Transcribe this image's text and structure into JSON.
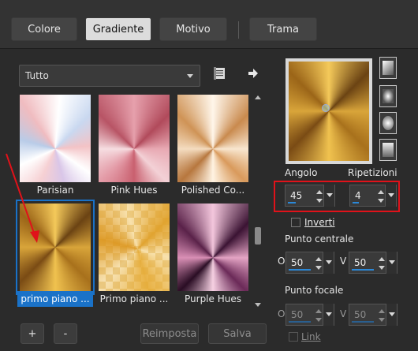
{
  "tabs": [
    {
      "label": "Colore",
      "active": false
    },
    {
      "label": "Gradiente",
      "active": true
    },
    {
      "label": "Motivo",
      "active": false
    },
    {
      "label": "Trama",
      "active": false
    }
  ],
  "category_dropdown": {
    "value": "Tutto"
  },
  "presets": [
    {
      "name": "Parisian",
      "selected": false
    },
    {
      "name": "Pink Hues",
      "selected": false
    },
    {
      "name": "Polished Co...",
      "selected": false
    },
    {
      "name": "primo piano ...",
      "selected": true
    },
    {
      "name": "Primo piano ...",
      "selected": false
    },
    {
      "name": "Purple Hues",
      "selected": false
    }
  ],
  "buttons": {
    "add": "+",
    "remove": "-",
    "reset": "Reimposta",
    "save": "Salva"
  },
  "settings": {
    "angle_label": "Angolo",
    "repeats_label": "Ripetizioni",
    "angle_value": "45",
    "angle_fraction": 0.125,
    "repeats_value": "4",
    "repeats_fraction": 0.04,
    "invert_label": "Inverti",
    "center_label": "Punto centrale",
    "center_h_label": "O",
    "center_v_label": "V",
    "center_h_value": "50",
    "center_v_value": "50",
    "focal_label": "Punto focale",
    "focal_h_label": "O",
    "focal_v_label": "V",
    "focal_h_value": "50",
    "focal_v_value": "50",
    "link_label": "Link"
  },
  "colors": {
    "accent": "#1a72c8",
    "highlight": "#e0121a",
    "annotation_arrow": "#e0121a"
  }
}
